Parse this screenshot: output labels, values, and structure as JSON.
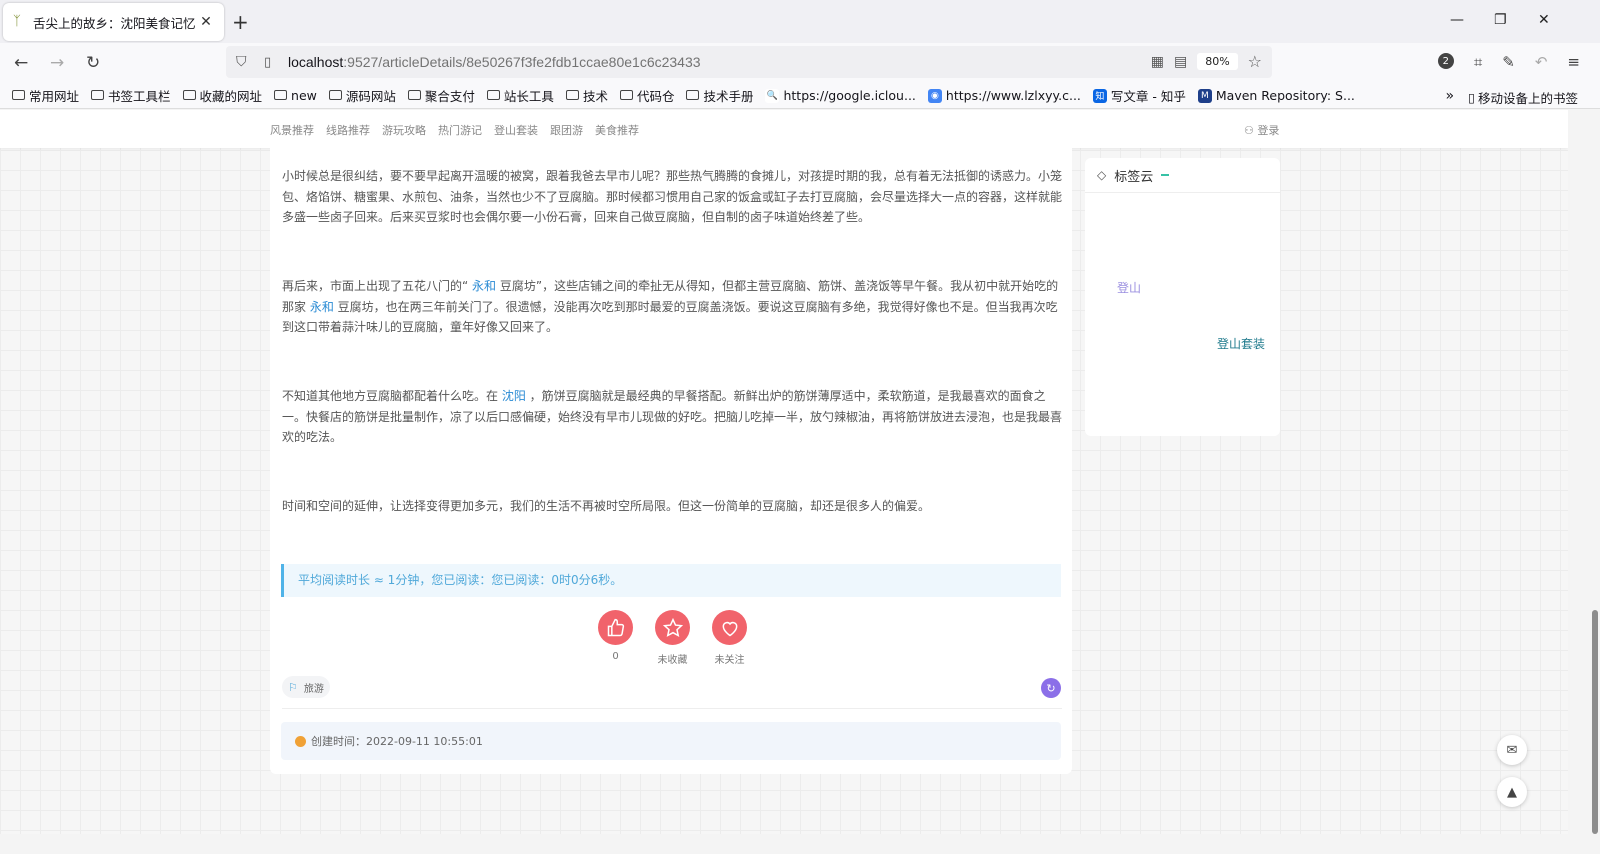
{
  "browser": {
    "tab_title": "舌尖上的故乡：沈阳美食记忆",
    "url_host": "localhost",
    "url_path": ":9527/articleDetails/8e50267f3fe2fdb1ccae80e1c6c23433",
    "zoom": "80%",
    "badge_count": "2",
    "bookmarks": [
      {
        "label": "常用网址",
        "kind": "folder"
      },
      {
        "label": "书签工具栏",
        "kind": "folder"
      },
      {
        "label": "收藏的网址",
        "kind": "folder"
      },
      {
        "label": "new",
        "kind": "folder"
      },
      {
        "label": "源码网站",
        "kind": "folder"
      },
      {
        "label": "聚合支付",
        "kind": "folder"
      },
      {
        "label": "站长工具",
        "kind": "folder"
      },
      {
        "label": "技术",
        "kind": "folder"
      },
      {
        "label": "代码仓",
        "kind": "folder"
      },
      {
        "label": "技术手册",
        "kind": "folder"
      },
      {
        "label": "https://google.iclou...",
        "kind": "search"
      },
      {
        "label": "https://www.lzlxyy.c...",
        "kind": "chrome"
      },
      {
        "label": "写文章 - 知乎",
        "kind": "zhihu"
      },
      {
        "label": "Maven Repository: S...",
        "kind": "maven"
      }
    ],
    "mobile_bookmarks": "移动设备上的书签"
  },
  "site": {
    "nav": [
      "风景推荐",
      "线路推荐",
      "游玩攻略",
      "热门游记",
      "登山套装",
      "跟团游",
      "美食推荐"
    ],
    "login": "登录"
  },
  "article": {
    "p1": "小时候总是很纠结，要不要早起离开温暖的被窝，跟着我爸去早市儿呢？那些热气腾腾的食摊儿，对孩提时期的我，总有着无法抵御的诱惑力。小笼包、烙馅饼、糖蜜果、水煎包、油条，当然也少不了豆腐脑。那时候都习惯用自己家的饭盒或缸子去打豆腐脑，会尽量选择大一点的容器，这样就能多盛一些卤子回来。后来买豆浆时也会偶尔要一小份石膏，回来自己做豆腐脑，但自制的卤子味道始终差了些。",
    "p2_a": "再后来，市面上出现了五花八门的“ ",
    "p2_link1": "永和",
    "p2_b": " 豆腐坊”，这些店铺之间的牵扯无从得知，但都主营豆腐脑、筋饼、盖浇饭等早午餐。我从初中就开始吃的那家 ",
    "p2_link2": "永和",
    "p2_c": " 豆腐坊，也在两三年前关门了。很遗憾，没能再次吃到那时最爱的豆腐盖浇饭。要说这豆腐脑有多绝，我觉得好像也不是。但当我再次吃到这口带着蒜汁味儿的豆腐脑，童年好像又回来了。",
    "p3_a": "不知道其他地方豆腐脑都配着什么吃。在 ",
    "p3_link": "沈阳",
    "p3_b": " ，筋饼豆腐脑就是最经典的早餐搭配。新鲜出炉的筋饼薄厚适中，柔软筋道，是我最喜欢的面食之一。快餐店的筋饼是批量制作，凉了以后口感偏硬，始终没有早市儿现做的好吃。把脑儿吃掉一半，放勺辣椒油，再将筋饼放进去浸泡，也是我最喜欢的吃法。",
    "p4": "时间和空间的延伸，让选择变得更加多元，我们的生活不再被时空所局限。但这一份简单的豆腐脑，却还是很多人的偏爱。",
    "read_info": "平均阅读时长 ≈ 1分钟，您已阅读：您已阅读：0时0分6秒。",
    "like_count": "0",
    "collect_label": "未收藏",
    "follow_label": "未关注",
    "tag": "旅游",
    "created": "创建时间：2022-09-11 10:55:01"
  },
  "sidebar": {
    "title": "标签云",
    "tags": [
      "登山",
      "登山套装"
    ],
    "tag_colors": [
      "#9b8fe0",
      "#1f7a8c"
    ]
  },
  "colors": {
    "accent_red": "#f1636b",
    "link_blue": "#2a8bd4",
    "read_blue": "#4fa8d9"
  }
}
